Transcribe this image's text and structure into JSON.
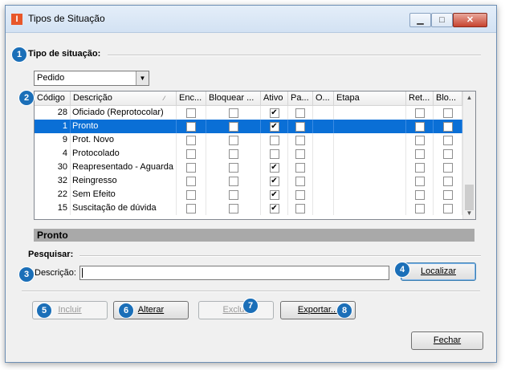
{
  "window": {
    "title": "Tipos de Situação",
    "icon_letter": "I",
    "minimize": "▁",
    "maximize": "□",
    "close": "✕"
  },
  "badges": [
    "1",
    "2",
    "3",
    "4",
    "5",
    "6",
    "7",
    "8"
  ],
  "tipo": {
    "label": "Tipo de situação:",
    "selected": "Pedido"
  },
  "grid": {
    "columns": [
      "Código",
      "Descrição",
      "Enc...",
      "Bloquear ...",
      "Ativo",
      "Pa...",
      "O...",
      "Etapa",
      "Ret...",
      "Blo..."
    ],
    "rows": [
      {
        "codigo": "28",
        "descricao": "Oficiado (Reprotocolar)",
        "ativo": true
      },
      {
        "codigo": "1",
        "descricao": "Pronto",
        "ativo": true
      },
      {
        "codigo": "9",
        "descricao": "Prot. Novo",
        "ativo": false
      },
      {
        "codigo": "4",
        "descricao": "Protocolado",
        "ativo": false
      },
      {
        "codigo": "30",
        "descricao": "Reapresentado - Aguarda",
        "ativo": true
      },
      {
        "codigo": "32",
        "descricao": "Reingresso",
        "ativo": true
      },
      {
        "codigo": "22",
        "descricao": "Sem Efeito",
        "ativo": true
      },
      {
        "codigo": "15",
        "descricao": "Suscitação de dúvida",
        "ativo": true
      }
    ],
    "selected_index": 1
  },
  "selected_name": "Pronto",
  "search": {
    "group_label": "Pesquisar:",
    "field_label": "Descrição:",
    "value": "",
    "button": "Localizar"
  },
  "actions": {
    "incluir": "Incluir",
    "alterar": "Alterar",
    "excluir": "Excluir",
    "exportar": "Exportar..."
  },
  "fechar": "Fechar"
}
